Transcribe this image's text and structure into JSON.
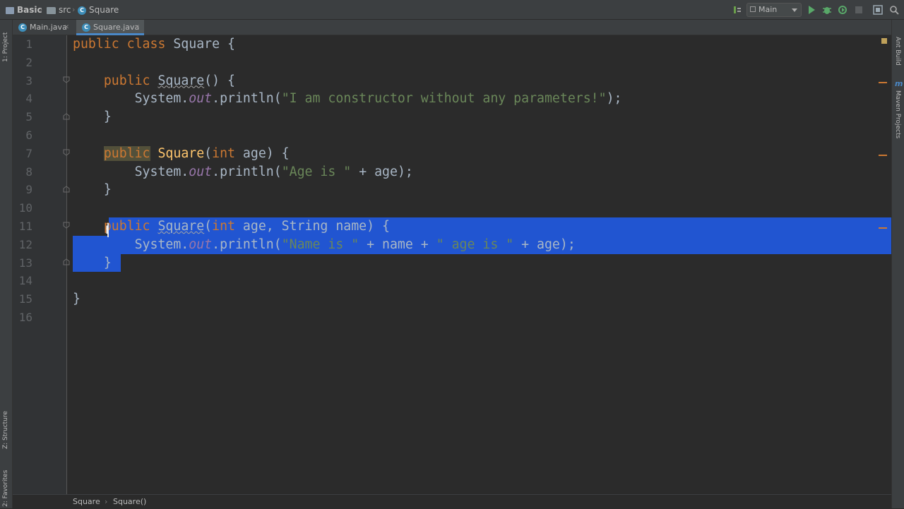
{
  "navbar": {
    "project": "Basic",
    "folder": "src",
    "class_name": "Square",
    "run_config": "Main"
  },
  "tabs": [
    {
      "label": "Main.java",
      "active": false
    },
    {
      "label": "Square.java",
      "active": true
    }
  ],
  "left_stripe": {
    "project": "1: Project",
    "structure": "Z: Structure",
    "favorites": "2: Favorites"
  },
  "right_stripe": {
    "ant_build": "Ant Build",
    "maven_projects": "Maven Projects"
  },
  "editor": {
    "line_numbers": [
      "1",
      "2",
      "3",
      "4",
      "5",
      "6",
      "7",
      "8",
      "9",
      "10",
      "11",
      "12",
      "13",
      "14",
      "15",
      "16"
    ],
    "code": {
      "l1_kw": "public class",
      "l1_rest": " Square {",
      "l3_kw": "public",
      "l3_name": "Square",
      "l3_rest": "() {",
      "l4_a": "System.",
      "l4_b": "out",
      "l4_c": ".println(",
      "l4_str": "\"I am constructor without any parameters!\"",
      "l4_d": ");",
      "l5": "}",
      "l7_kw": "public",
      "l7_name": "Square",
      "l7_a": "(",
      "l7_kw2": "int",
      "l7_rest": " age) {",
      "l8_a": "System.",
      "l8_b": "out",
      "l8_c": ".println(",
      "l8_str": "\"Age is \"",
      "l8_d": " + age);",
      "l9": "}",
      "l11_kw": "public",
      "l11_name": "Square",
      "l11_a": "(",
      "l11_kw2": "int",
      "l11_rest": " age, String name) {",
      "l12_a": "System.",
      "l12_b": "out",
      "l12_c": ".println(",
      "l12_str1": "\"Name is \"",
      "l12_mid": " + name + ",
      "l12_str2": "\" age is \"",
      "l12_d": " + age);",
      "l13": "}",
      "l15": "}"
    }
  },
  "breadcrumbs": {
    "class": "Square",
    "method": "Square()"
  }
}
